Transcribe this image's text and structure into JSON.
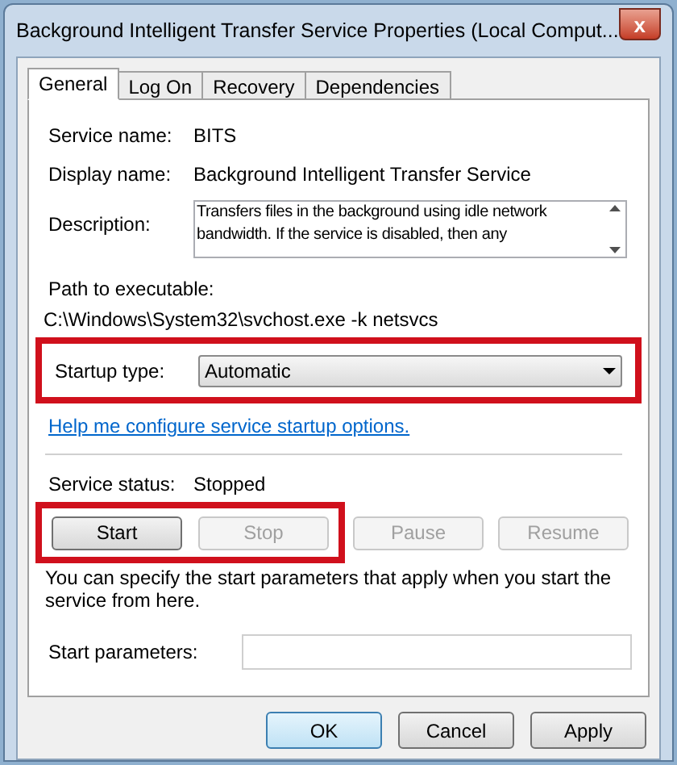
{
  "window": {
    "title": "Background Intelligent Transfer Service Properties (Local Comput...",
    "close": "x"
  },
  "tabs": [
    {
      "label": "General",
      "selected": true
    },
    {
      "label": "Log On",
      "selected": false
    },
    {
      "label": "Recovery",
      "selected": false
    },
    {
      "label": "Dependencies",
      "selected": false
    }
  ],
  "service_name": {
    "label": "Service name:",
    "value": "BITS"
  },
  "display_name": {
    "label": "Display name:",
    "value": "Background Intelligent Transfer Service"
  },
  "description": {
    "label": "Description:",
    "value": "Transfers files in the background using idle network bandwidth. If the service is disabled, then any"
  },
  "path": {
    "label": "Path to executable:",
    "value": "C:\\Windows\\System32\\svchost.exe -k netsvcs"
  },
  "startup_type": {
    "label": "Startup type:",
    "value": "Automatic"
  },
  "highlight_frames": {
    "startup_type": true,
    "start_stop": true
  },
  "help_link": "Help me configure service startup options.",
  "service_status": {
    "label": "Service status:",
    "value": "Stopped"
  },
  "control_buttons": [
    {
      "label": "Start",
      "disabled": false
    },
    {
      "label": "Stop",
      "disabled": true
    },
    {
      "label": "Pause",
      "disabled": true
    },
    {
      "label": "Resume",
      "disabled": true
    }
  ],
  "note": "You can specify the start parameters that apply when you start the service from here.",
  "start_parameters": {
    "label": "Start parameters:"
  },
  "dialog_buttons": [
    {
      "label": "OK",
      "default": true
    },
    {
      "label": "Cancel",
      "default": false
    },
    {
      "label": "Apply",
      "default": false
    }
  ]
}
